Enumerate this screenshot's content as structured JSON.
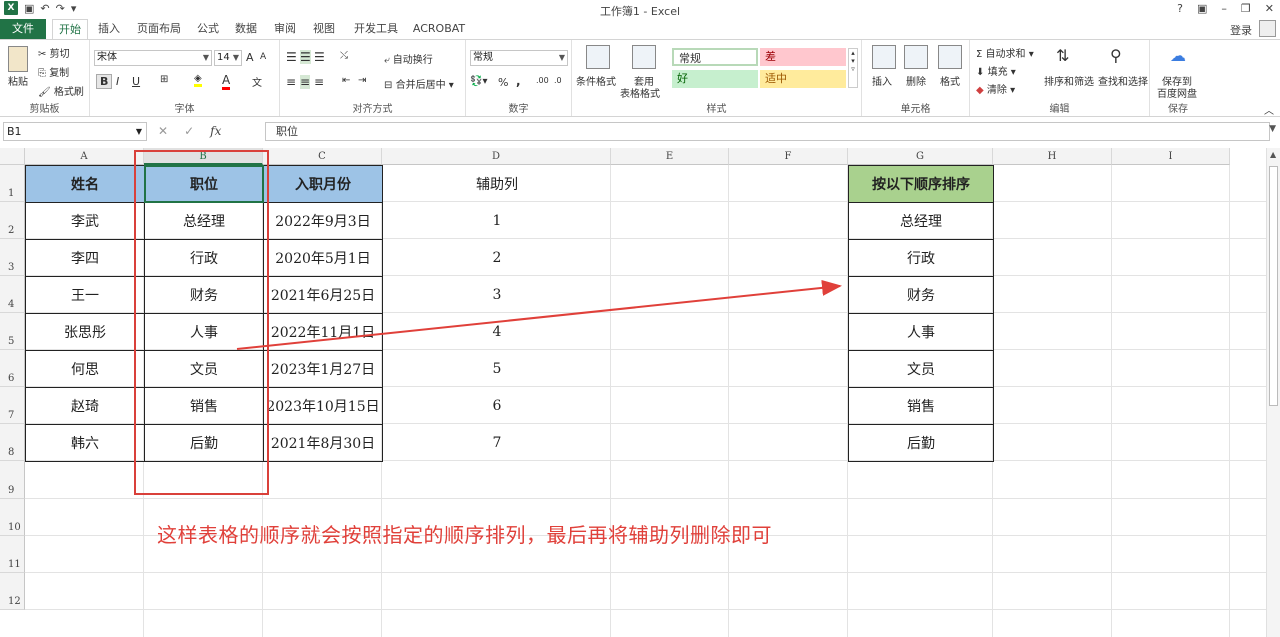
{
  "titlebar": {
    "title": "工作簿1 - Excel",
    "help": "?",
    "undo": "↶",
    "redo": "↷"
  },
  "tabs": [
    "文件",
    "开始",
    "插入",
    "页面布局",
    "公式",
    "数据",
    "审阅",
    "视图",
    "开发工具",
    "ACROBAT"
  ],
  "login": "登录",
  "ribbon": {
    "clipboard": {
      "paste": "粘贴",
      "cut": "剪切",
      "copy": "复制",
      "painter": "格式刷",
      "label": "剪贴板"
    },
    "font": {
      "name": "宋体",
      "size": "14",
      "bold": "B",
      "italic": "I",
      "underline": "U",
      "grow": "A",
      "shrink": "A",
      "label": "字体"
    },
    "align": {
      "wrap": "自动换行",
      "merge": "合并后居中",
      "label": "对齐方式"
    },
    "number": {
      "format": "常规",
      "percent": "%",
      "comma": ",",
      "label": "数字"
    },
    "styles": {
      "cond": "条件格式",
      "table_line1": "套用",
      "table_line2": "表格格式",
      "normal": "常规",
      "bad": "差",
      "good": "好",
      "neutral": "适中",
      "label": "样式"
    },
    "cells": {
      "insert": "插入",
      "delete": "删除",
      "format": "格式",
      "label": "单元格"
    },
    "edit": {
      "autosum": "自动求和",
      "fill": "填充",
      "clear": "清除",
      "sort": "排序和筛选",
      "find": "查找和选择",
      "label": "编辑"
    },
    "save": {
      "line1": "保存到",
      "line2": "百度网盘",
      "label": "保存"
    }
  },
  "formula_bar": {
    "namebox": "B1",
    "fx": "fx",
    "value": "职位"
  },
  "sheet": {
    "columns": [
      "A",
      "B",
      "C",
      "D",
      "E",
      "F",
      "G",
      "H",
      "I"
    ],
    "rows": [
      "1",
      "2",
      "3",
      "4",
      "5",
      "6",
      "7",
      "8",
      "9",
      "10",
      "11",
      "12"
    ],
    "table_headers": [
      "姓名",
      "职位",
      "入职月份"
    ],
    "table_rows": [
      [
        "李武",
        "总经理",
        "2022年9月3日"
      ],
      [
        "李四",
        "行政",
        "2020年5月1日"
      ],
      [
        "王一",
        "财务",
        "2021年6月25日"
      ],
      [
        "张思彤",
        "人事",
        "2022年11月1日"
      ],
      [
        "何思",
        "文员",
        "2023年1月27日"
      ],
      [
        "赵琦",
        "销售",
        "2023年10月15日"
      ],
      [
        "韩六",
        "后勤",
        "2021年8月30日"
      ]
    ],
    "helper_header": "辅助列",
    "helper_values": [
      "1",
      "2",
      "3",
      "4",
      "5",
      "6",
      "7"
    ],
    "order_header": "按以下顺序排序",
    "order_values": [
      "总经理",
      "行政",
      "财务",
      "人事",
      "文员",
      "销售",
      "后勤"
    ]
  },
  "annotation": "这样表格的顺序就会按照指定的顺序排列，最后再将辅助列删除即可",
  "colors": {
    "excel_green": "#217346",
    "header_blue": "#9dc3e6",
    "header_green": "#a9d18e",
    "annotation_red": "#e0403a",
    "style_bad": "#ffc7ce",
    "style_good": "#c6efce",
    "style_neutral": "#ffeb9c"
  }
}
